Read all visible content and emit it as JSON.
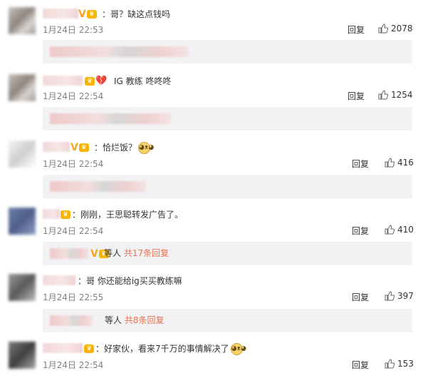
{
  "comments": [
    {
      "text": "：哥？缺这点钱吗",
      "time": "1月24日 22:53",
      "reply_label": "回复",
      "likes": "2078",
      "badges": [
        "vip-v",
        "crown"
      ]
    },
    {
      "text": "IG 教练 咚咚咚",
      "time": "1月24日 22:54",
      "reply_label": "回复",
      "likes": "1254",
      "badges": [
        "crown",
        "broken-heart"
      ]
    },
    {
      "text": "：恰烂饭？",
      "time": "1月24日 22:54",
      "reply_label": "回复",
      "likes": "416",
      "badges": [
        "vip-v",
        "crown"
      ],
      "emoji": "doge-emoji"
    },
    {
      "text": "：刚刚，王思聪转发广告了。",
      "time": "1月24日 22:54",
      "reply_label": "回复",
      "likes": "410",
      "badges": [
        "crown"
      ],
      "sub_replies": {
        "others": "等人",
        "count_text": "共17条回复"
      }
    },
    {
      "text": "：哥 你还能给ig买买教练嘛",
      "time": "1月24日 22:55",
      "reply_label": "回复",
      "likes": "397",
      "badges": [],
      "sub_replies": {
        "others": "等人",
        "count_text": "共8条回复"
      }
    },
    {
      "text": "：好家伙，看来7千万的事情解决了",
      "time": "1月24日 22:54",
      "reply_label": "回复",
      "likes": "153",
      "badges": [
        "crown"
      ],
      "emoji": "doge-emoji"
    }
  ],
  "colors": {
    "sub_reply_bg": "#f2f2f5",
    "count_link": "#eb7350",
    "vip": "#f5a623",
    "crown": "#f7b500",
    "time": "#808080"
  }
}
